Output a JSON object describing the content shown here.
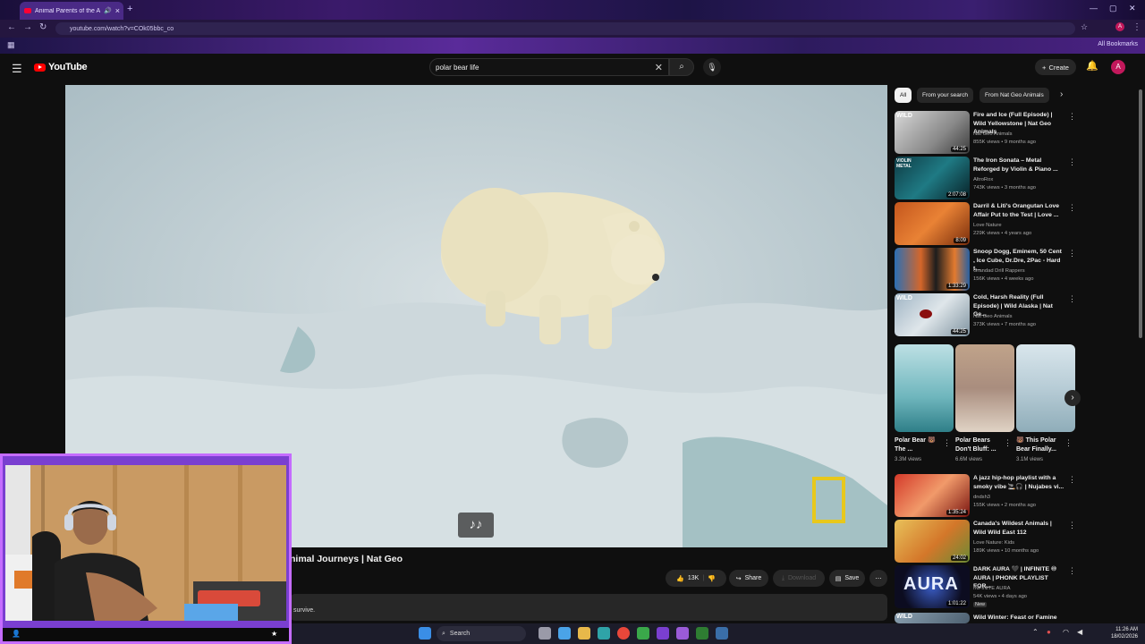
{
  "browser": {
    "tab_title": "Animal Parents of the Arcti",
    "tab_close": "×",
    "new_tab": "+",
    "url": "youtube.com/watch?v=COk05bbc_co",
    "all_bookmarks": "All Bookmarks",
    "accent": "#4a2a86"
  },
  "youtube": {
    "logo_text": "YouTube",
    "search_value": "polar bear life",
    "create_label": "Create",
    "avatar_letter": "A"
  },
  "video": {
    "title": "nimal Journeys | Nat Geo",
    "mute_glyph": "♪♪",
    "description_snippet": "survive.",
    "actions": {
      "likes": "13K",
      "share": "Share",
      "download": "Download",
      "save": "Save"
    }
  },
  "sidebar": {
    "chips": [
      "All",
      "From your search",
      "From Nat Geo Animals"
    ],
    "recommendations": [
      {
        "title": "Fire and Ice (Full Episode) | Wild Yellowstone | Nat Geo Animals",
        "channel": "Nat Geo Animals",
        "meta": "855K views • 9 months ago",
        "duration": "44:25",
        "badge": "WILD"
      },
      {
        "title": "The Iron Sonata – Metal Reforged by Violin & Piano ...",
        "channel": "AltroRox",
        "meta": "743K views • 3 months ago",
        "duration": "2:07:08",
        "badge": "VIOLIN METAL"
      },
      {
        "title": "Darril & Liti's Orangutan Love Affair Put to the Test | Love ...",
        "channel": "Love Nature",
        "meta": "229K views • 4 years ago",
        "duration": "8:09",
        "badge": ""
      },
      {
        "title": "Snoop Dogg, Eminem, 50 Cent , Ice Cube, Dr.Dre, 2Pac - Hard t...",
        "channel": "Grandad Drill Rappers",
        "meta": "156K views • 4 weeks ago",
        "duration": "1:33:29",
        "badge": ""
      },
      {
        "title": "Cold, Harsh Reality (Full Episode) | Wild Alaska | Nat Ge...",
        "channel": "Nat Geo Animals",
        "meta": "373K views • 7 months ago",
        "duration": "44:25",
        "badge": "WILD"
      }
    ],
    "shorts": [
      {
        "title": "Polar Bear 🐻 The ...",
        "views": "3.3M views"
      },
      {
        "title": "Polar Bears Don't Bluff: ...",
        "views": "6.6M views"
      },
      {
        "title": "🐻 This Polar Bear Finally...",
        "views": "3.1M views"
      }
    ],
    "recommendations2": [
      {
        "title": "A jazz hip-hop playlist with a smoky vibe 🚬🎧 | Nujabes vi...",
        "channel": "dndsh3",
        "meta": "155K views • 2 months ago",
        "duration": "1:35:24"
      },
      {
        "title": "Canada's Wildest Animals | Wild Wild East 112",
        "channel": "Love Nature: Kids",
        "meta": "189K views • 10 months ago",
        "duration": "24:02"
      },
      {
        "title": "DARK AURA 🖤 | INFINITE ♾ AURA | PHONK PLAYLIST FOR...",
        "channel": "INFINITE AURA",
        "meta": "54K views • 4 days ago",
        "duration": "1:01:22",
        "badge_new": "New"
      },
      {
        "title": "Wild Winter: Feast or Famine",
        "channel": "",
        "meta": "",
        "duration": "",
        "badge": "WILD"
      }
    ]
  },
  "taskbar": {
    "search_label": "Search",
    "time": "11:26 AM",
    "date": "18/02/2026"
  }
}
